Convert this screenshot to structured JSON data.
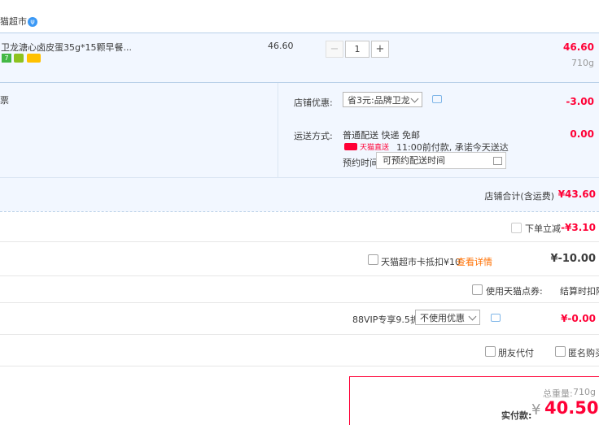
{
  "shop": {
    "name": "猫超市",
    "badge": "🐱"
  },
  "item": {
    "title": "卫龙溏心卤皮蛋35g*15颗早餐...",
    "unit_price": "46.60",
    "quantity": "1",
    "minus": "−",
    "plus": "+",
    "total": "46.60",
    "weight": "710g"
  },
  "left_label": "票",
  "shop_discount": {
    "label": "店铺优惠:",
    "value": "省3元:品牌卫龙",
    "amount": "-3.00"
  },
  "shipping": {
    "label": "运送方式:",
    "method": "普通配送 快递 免邮",
    "express_tag": "天猫直送",
    "promise": "11:00前付款, 承诺今天送达",
    "reserve_label": "预约时间",
    "reserve_placeholder": "可预约配送时间",
    "amount": "0.00"
  },
  "shop_total": {
    "label": "店铺合计(含运费)",
    "amount": "¥43.60"
  },
  "instant_discount": {
    "label": "下单立减",
    "amount": "-¥3.10"
  },
  "card_deduct": {
    "label": "天猫超市卡抵扣¥10",
    "link": "查看详情",
    "amount": "¥-10.00"
  },
  "points": {
    "label": "使用天猫点券:",
    "note": "结算时扣除"
  },
  "vip": {
    "label": "88VIP专享9.5折",
    "select": "不使用优惠",
    "amount": "¥-0.00"
  },
  "friend_pay": "朋友代付",
  "anonymous": "匿名购买",
  "summary": {
    "weight_label": "总重量:",
    "weight": "710g",
    "pay_label": "实付款:",
    "currency": "¥",
    "amount": "40.50"
  },
  "colors": {
    "accent": "#ff0036",
    "highlight_bg": "#f2f7ff",
    "link": "#ff6f00"
  }
}
